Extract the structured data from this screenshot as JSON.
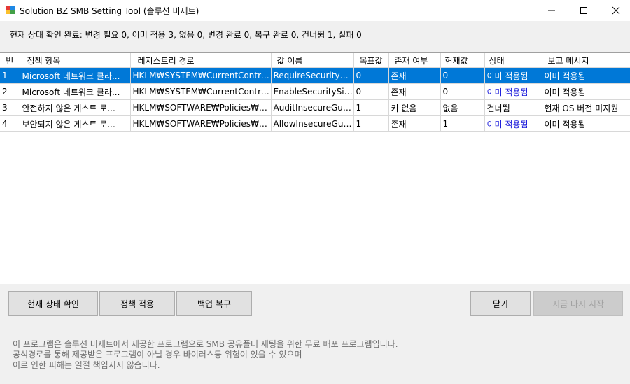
{
  "window": {
    "title": "Solution BZ SMB Setting Tool (솔루션 비제트)",
    "minimize_icon": "minimize-icon",
    "maximize_icon": "maximize-icon",
    "close_icon": "close-icon"
  },
  "status": {
    "text": "현재 상태 확인 완료: 변경 필요 0, 이미 적용 3, 없음 0, 변경 완료 0, 복구 완료 0, 건너뜀 1, 실패 0"
  },
  "grid": {
    "columns": [
      "번",
      "정책 항목",
      "레지스트리 경로",
      "값 이름",
      "목표값",
      "존재 여부",
      "현재값",
      "상태",
      "보고 메시지"
    ],
    "rows": [
      {
        "no": "1",
        "policy": "Microsoft 네트워크 클라...",
        "path": "HKLM₩SYSTEM₩CurrentControlS...",
        "value_name": "RequireSecuritySig...",
        "target": "0",
        "exists": "존재",
        "current": "0",
        "state": "이미 적용됨",
        "report": "이미 적용됨",
        "selected": true
      },
      {
        "no": "2",
        "policy": "Microsoft 네트워크 클라...",
        "path": "HKLM₩SYSTEM₩CurrentControlS...",
        "value_name": "EnableSecuritySig...",
        "target": "0",
        "exists": "존재",
        "current": "0",
        "state": "이미 적용됨",
        "report": "이미 적용됨",
        "selected": false
      },
      {
        "no": "3",
        "policy": "안전하지 않은 게스트 로...",
        "path": "HKLM₩SOFTWARE₩Policies₩Micr...",
        "value_name": "AuditInsecureGues...",
        "target": "1",
        "exists": "키 없음",
        "current": "없음",
        "state": "건너뜀",
        "report": "현재 OS 버전 미지원",
        "selected": false
      },
      {
        "no": "4",
        "policy": "보안되지 않은 게스트 로...",
        "path": "HKLM₩SOFTWARE₩Policies₩Micr...",
        "value_name": "AllowInsecureGues...",
        "target": "1",
        "exists": "존재",
        "current": "1",
        "state": "이미 적용됨",
        "report": "이미 적용됨",
        "selected": false
      }
    ],
    "selected_color": "#0078d7",
    "applied_text_color": "#1a1adb"
  },
  "buttons": {
    "check": "현재 상태 확인",
    "apply": "정책 적용",
    "restore": "백업 복구",
    "close": "닫기",
    "restart": "지금 다시 시작"
  },
  "footer": {
    "line1": "이 프로그램은 솔루션 비제트에서 제공한 프로그램으로 SMB 공유폴더 세팅을 위한 무료 배포 프로그램입니다.",
    "line2": "공식경로를 통해 제공받은 프로그램이 아닐 경우 바이러스등 위험이 있을 수 있으며",
    "line3": "이로 인한 피해는 일절 책임지지 않습니다."
  }
}
